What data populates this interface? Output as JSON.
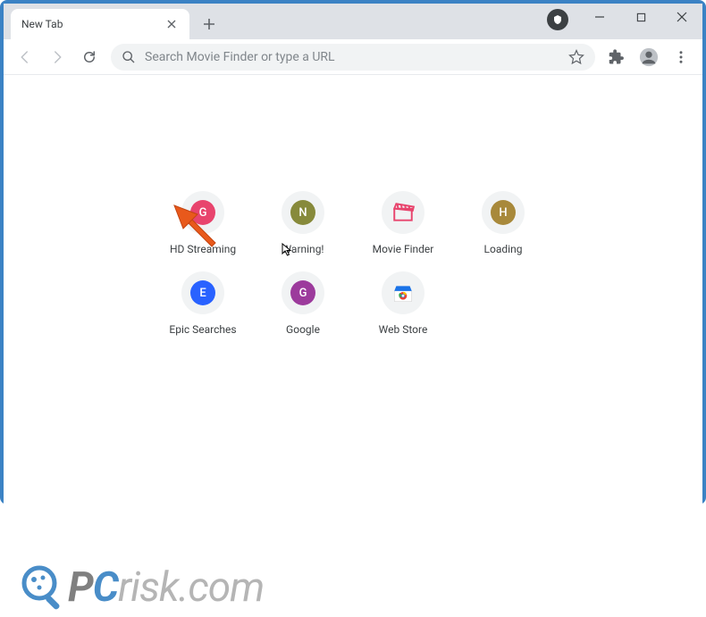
{
  "tab": {
    "title": "New Tab"
  },
  "omnibox": {
    "placeholder": "Search Movie Finder or type a URL"
  },
  "shortcuts": {
    "row1": [
      {
        "label": "HD Streaming",
        "letter": "G",
        "color": "#e8446d"
      },
      {
        "label": "Warning!",
        "letter": "N",
        "color": "#878a3b"
      },
      {
        "label": "Movie Finder",
        "letter": "",
        "color": "#e8446d",
        "isMovie": true
      },
      {
        "label": "Loading",
        "letter": "H",
        "color": "#a8893b"
      }
    ],
    "row2": [
      {
        "label": "Epic Searches",
        "letter": "E",
        "color": "#2962ff"
      },
      {
        "label": "Google",
        "letter": "G",
        "color": "#9c3b9c"
      },
      {
        "label": "Web Store",
        "letter": "",
        "color": "#fff",
        "isStore": true
      }
    ]
  },
  "watermark": {
    "p": "P",
    "c": "C",
    "rest": "risk.com"
  }
}
